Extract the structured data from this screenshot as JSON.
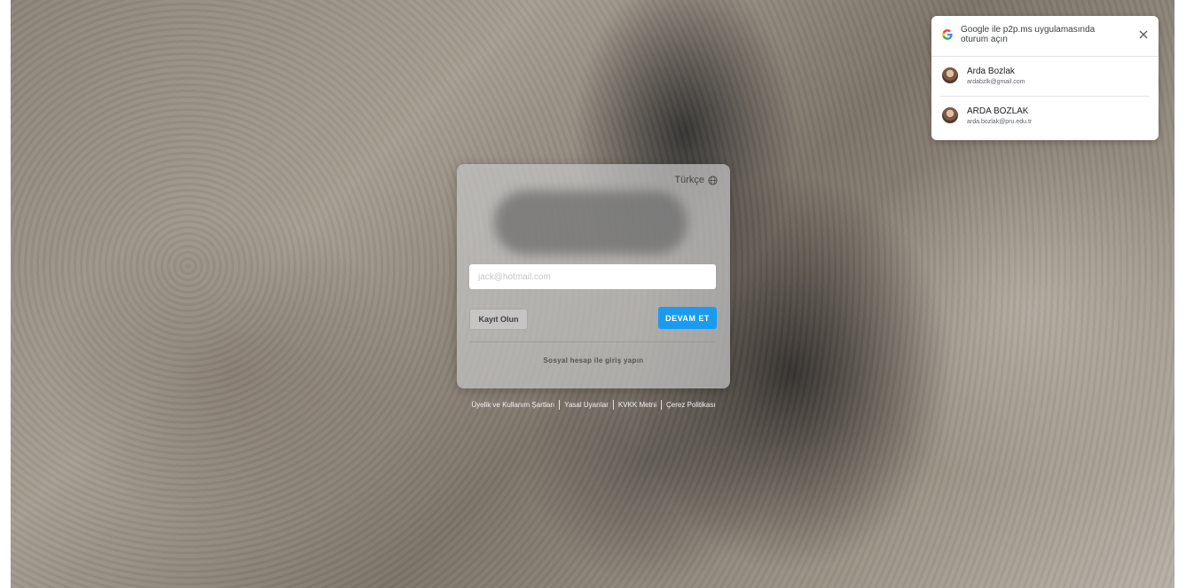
{
  "login": {
    "language": "Türkçe",
    "email_placeholder": "jack@hotmail.com",
    "register_label": "Kayıt Olun",
    "continue_label": "DEVAM ET",
    "social_login_label": "Sosyal hesap ile giriş yapın",
    "accent_color": "#1a9bf2"
  },
  "footer": {
    "links": [
      "Üyelik ve Kullanım Şartları",
      "Yasal Uyarılar",
      "KVKK Metni",
      "Çerez Politikası"
    ]
  },
  "google_popup": {
    "title": "Google ile p2p.ms uygulamasında oturum açın",
    "accounts": [
      {
        "name": "Arda Bozlak",
        "email": "ardabzlk@gmail.com"
      },
      {
        "name": "ARDA BOZLAK",
        "email": "arda.bozlak@pru.edu.tr"
      }
    ]
  },
  "icons": {
    "globe": "globe-icon",
    "google": "google-g-icon",
    "close": "close-icon"
  }
}
